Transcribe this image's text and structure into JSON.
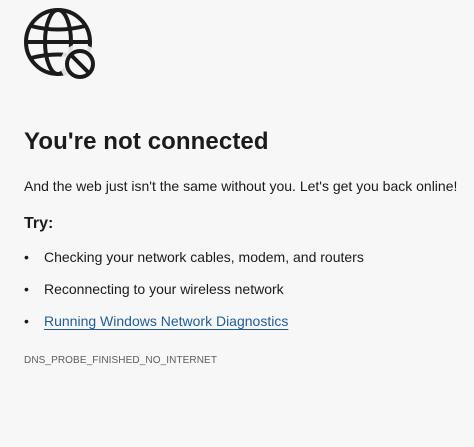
{
  "error_page": {
    "icon": "globe-blocked-icon",
    "title": "You're not connected",
    "subtitle": "And the web just isn't the same without you. Let's get you back online!",
    "try_heading": "Try:",
    "bullet_glyph": "•",
    "suggestions": [
      "Checking your network cables, modem, and routers",
      "Reconnecting to your wireless network"
    ],
    "diagnostics_link": "Running Windows Network Diagnostics",
    "error_code": "DNS_PROBE_FINISHED_NO_INTERNET",
    "colors": {
      "background": "#f7f7f7",
      "text": "#1b1b1b",
      "link": "#1f5d99",
      "error_code": "#5c5c5c"
    }
  }
}
